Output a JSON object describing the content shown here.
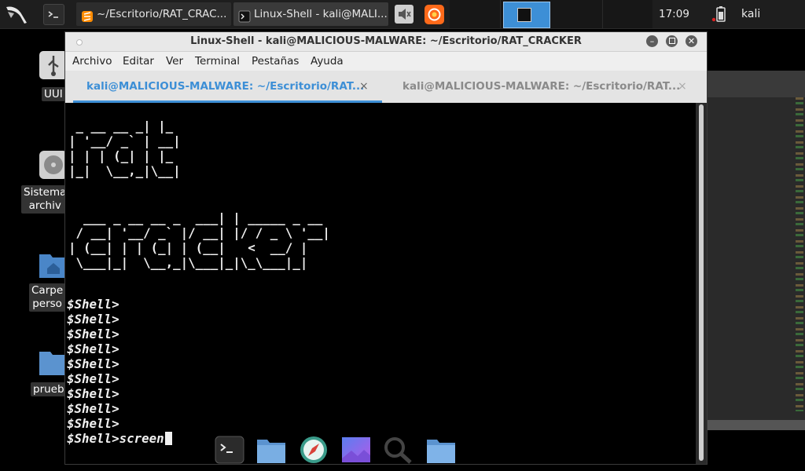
{
  "panel": {
    "tasks": [
      {
        "label": "~/Escritorio/RAT_CRAC..."
      },
      {
        "label": "Linux-Shell - kali@MALI..."
      }
    ],
    "clock": "17:09",
    "user": "kali"
  },
  "desktop": {
    "icons": [
      {
        "label": "UUI",
        "icon": "usb-drive-icon"
      },
      {
        "label": "Sistema",
        "label2": "archiv",
        "icon": "hard-disk-icon"
      },
      {
        "label": "Carpe",
        "label2": "perso",
        "icon": "home-folder-icon"
      },
      {
        "label": "prueb",
        "icon": "folder-icon"
      }
    ]
  },
  "window": {
    "title": "Linux-Shell - kali@MALICIOUS-MALWARE: ~/Escritorio/RAT_CRACKER",
    "menu": [
      "Archivo",
      "Editar",
      "Ver",
      "Terminal",
      "Pestañas",
      "Ayuda"
    ],
    "tabs": [
      {
        "label": "kali@MALICIOUS-MALWARE: ~/Escritorio/RAT...",
        "active": true
      },
      {
        "label": "kali@MALICIOUS-MALWARE: ~/Escritorio/RAT...",
        "active": false
      }
    ],
    "close_glyph": "×"
  },
  "terminal": {
    "banner_rat": " _ __ __ _| |_\n| '__/ _` | __|\n| | | (_| | |_\n|_|  \\__,_|\\__|",
    "banner_cracker": "  ___ _ __ __ _  ___| | _____ _ __\n / __| '__/ _` |/ __| |/ / _ \\ '__|\n| (__| | | (_| | (__|   <  __/ |\n \\___|_|  \\__,_|\\___|_|\\_\\___|_|",
    "prompts": [
      "$Shell>",
      "$Shell>",
      "$Shell>",
      "$Shell>",
      "$Shell>",
      "$Shell>",
      "$Shell>",
      "$Shell>",
      "$Shell>"
    ],
    "current_prompt": "$Shell>",
    "current_input": "screen"
  },
  "dock": [
    "terminal-app-icon",
    "files-app-icon",
    "browser-compass-icon",
    "image-viewer-icon",
    "search-app-icon",
    "folder-app-icon"
  ],
  "colors": {
    "accent": "#3d8fd6",
    "panel": "#1e1e1e",
    "terminal_bg": "#000000",
    "terminal_fg": "#f0f0f0"
  }
}
